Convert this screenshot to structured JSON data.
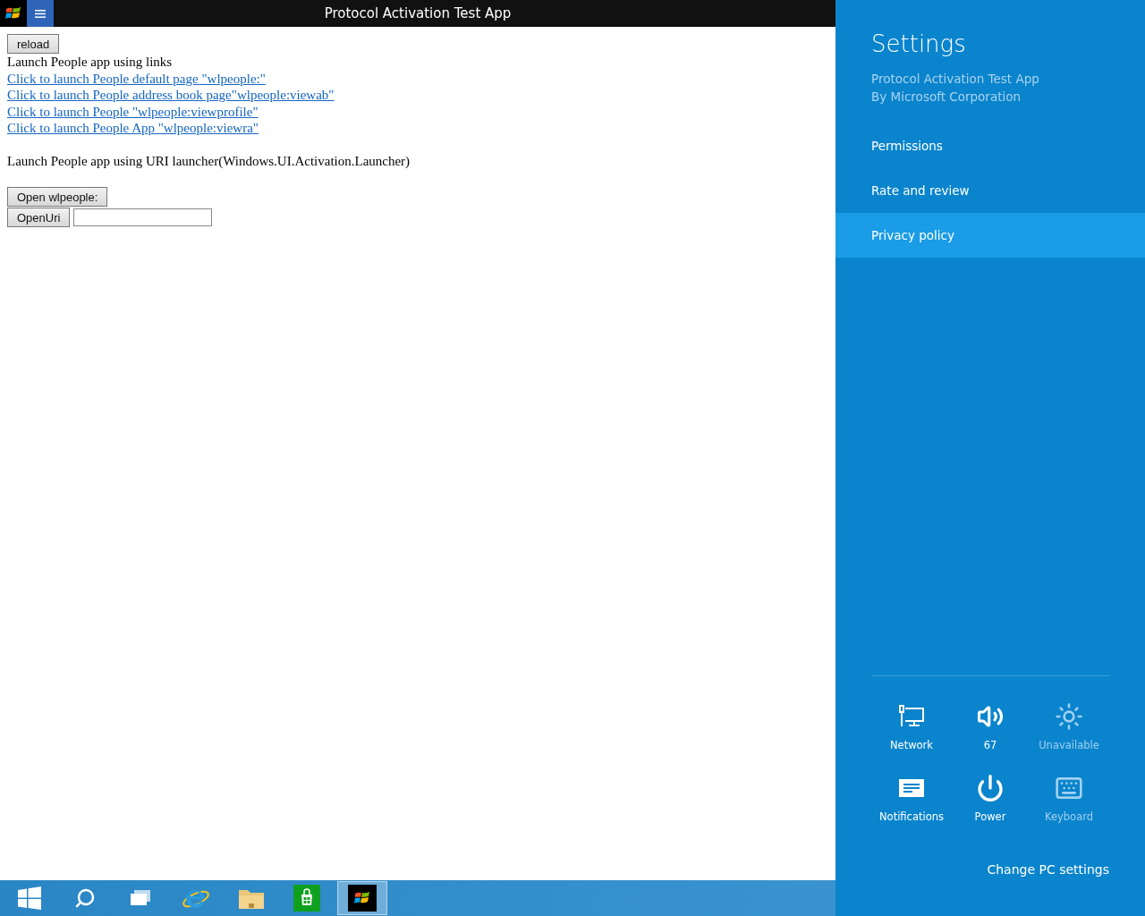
{
  "window": {
    "title": "Protocol Activation Test App"
  },
  "content": {
    "reload_button": "reload",
    "links_heading": "Launch People app using links",
    "links": [
      "Click to launch People default page \"wlpeople:\"",
      "Click to launch People address book page\"wlpeople:viewab\"",
      "Click to launch People \"wlpeople:viewprofile\"",
      "Click to launch People App \"wlpeople:viewra\""
    ],
    "launcher_heading": "Launch People app using URI launcher(Windows.UI.Activation.Launcher)",
    "open_button": "Open wlpeople:",
    "openuri_button": "OpenUri"
  },
  "taskbar": {
    "items": [
      {
        "selected": false
      },
      {
        "selected": false
      },
      {
        "selected": false
      },
      {
        "selected": false
      },
      {
        "selected": false
      },
      {
        "selected": false
      },
      {
        "selected": true
      }
    ]
  },
  "settings": {
    "title": "Settings",
    "app_name": "Protocol Activation Test App",
    "publisher": "By Microsoft Corporation",
    "items": [
      {
        "label": "Permissions",
        "selected": false
      },
      {
        "label": "Rate and review",
        "selected": false
      },
      {
        "label": "Privacy policy",
        "selected": true
      }
    ],
    "quick": [
      {
        "label": "Network",
        "disabled": false
      },
      {
        "label": "67",
        "disabled": false
      },
      {
        "label": "Unavailable",
        "disabled": true
      },
      {
        "label": "Notifications",
        "disabled": false
      },
      {
        "label": "Power",
        "disabled": false
      },
      {
        "label": "Keyboard",
        "disabled": true
      }
    ],
    "change_link": "Change PC settings"
  }
}
